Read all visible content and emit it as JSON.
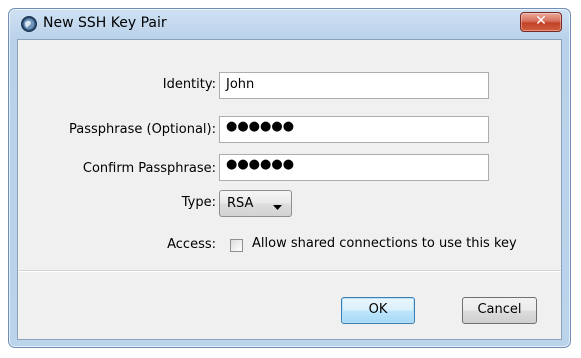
{
  "window": {
    "title": "New SSH Key Pair",
    "close_label": "✕",
    "app_icon": "globe-icon"
  },
  "form": {
    "identity": {
      "label": "Identity:",
      "value": "John"
    },
    "passphrase": {
      "label": "Passphrase (Optional):",
      "value": "●●●●●●"
    },
    "confirm": {
      "label": "Confirm Passphrase:",
      "value": "●●●●●●"
    },
    "type": {
      "label": "Type:",
      "selected": "RSA"
    },
    "access": {
      "label": "Access:",
      "checkbox_label": "Allow shared connections to use this key",
      "checked": false
    }
  },
  "buttons": {
    "ok": "OK",
    "cancel": "Cancel"
  }
}
